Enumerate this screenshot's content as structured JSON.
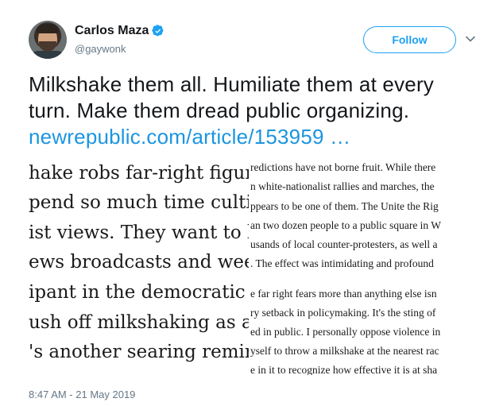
{
  "user": {
    "display_name": "Carlos Maza",
    "handle": "@gaywonk",
    "follow_label": "Follow"
  },
  "tweet": {
    "text": "Milkshake them all. Humiliate them at every turn. Make them dread public organizing. ",
    "link": "newrepublic.com/article/153959 …",
    "timestamp": "8:47 AM - 21 May 2019"
  },
  "card": {
    "left_lines": [
      "hake robs far-right figures",
      "pend so much time cultiva",
      "ist views. They want to be",
      "ews broadcasts and weeker",
      "ipant in the democratic pr",
      "ush off milkshaking as a h",
      "'s another searing reminde"
    ],
    "right_lines": [
      "redictions have not borne fruit. While there",
      "n white-nationalist rallies and marches, the",
      "ppears to be one of them. The Unite the Rig",
      "an two dozen people to a public square in W",
      "usands of local counter-protesters, as well a",
      ". The effect was intimidating and profound",
      "e far right fears more than anything else isn",
      "ry setback in policymaking. It's the sting of",
      "ed in public. I personally oppose violence in",
      "yself to throw a milkshake at the nearest rac",
      "e in it to recognize how effective it is at sha"
    ]
  },
  "colors": {
    "accent": "#1da1f2",
    "link": "#1b95e0",
    "secondary_text": "#657786"
  },
  "icons": [
    "verified-badge-icon",
    "chevron-down-icon"
  ]
}
